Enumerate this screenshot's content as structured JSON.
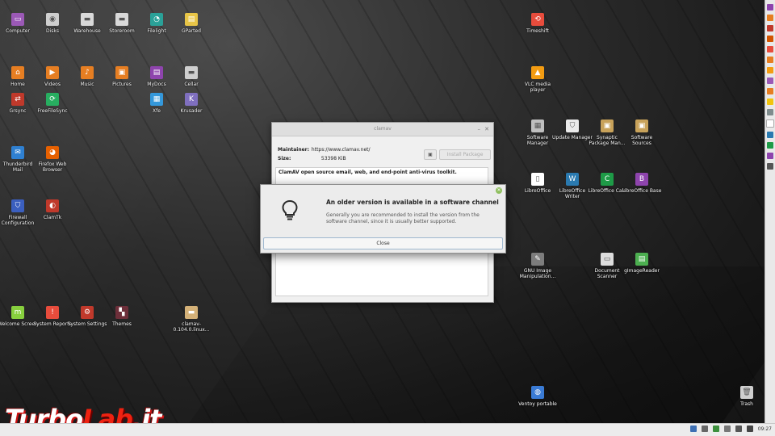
{
  "desktop": {
    "icons": [
      {
        "id": "computer",
        "label": "Computer",
        "icon": "monitor-icon",
        "color": "#9b59b6"
      },
      {
        "id": "disks",
        "label": "Disks",
        "icon": "disks-icon",
        "color": "#cfcfcf"
      },
      {
        "id": "warehouse",
        "label": "Warehouse",
        "icon": "drive-icon",
        "color": "#d9d9d9"
      },
      {
        "id": "storeroom",
        "label": "Storeroom",
        "icon": "drive-icon",
        "color": "#d9d9d9"
      },
      {
        "id": "filelight",
        "label": "Filelight",
        "icon": "filelight-icon",
        "color": "#2aa198"
      },
      {
        "id": "gparted",
        "label": "GParted",
        "icon": "gparted-icon",
        "color": "#e8c547"
      },
      {
        "id": "timeshift",
        "label": "Timeshift",
        "icon": "timeshift-icon",
        "color": "#e74c3c"
      },
      {
        "id": "home",
        "label": "Home",
        "icon": "folder-home-icon",
        "color": "#e67e22"
      },
      {
        "id": "videos",
        "label": "Videos",
        "icon": "folder-videos-icon",
        "color": "#e67e22"
      },
      {
        "id": "music",
        "label": "Music",
        "icon": "folder-music-icon",
        "color": "#e67e22"
      },
      {
        "id": "pictures",
        "label": "Pictures",
        "icon": "folder-pictures-icon",
        "color": "#e67e22"
      },
      {
        "id": "mydocs",
        "label": "MyDocs",
        "icon": "mydocs-icon",
        "color": "#8e44ad"
      },
      {
        "id": "cellar",
        "label": "Cellar",
        "icon": "folder-icon",
        "color": "#cfcfcf"
      },
      {
        "id": "vlc",
        "label": "VLC media player",
        "icon": "vlc-cone-icon",
        "color": "#f39c12"
      },
      {
        "id": "grsync",
        "label": "Grsync",
        "icon": "grsync-icon",
        "color": "#c0392b"
      },
      {
        "id": "freefilesync",
        "label": "FreeFileSync",
        "icon": "sync-icon",
        "color": "#27ae60"
      },
      {
        "id": "xfe",
        "label": "Xfe",
        "icon": "xfe-icon",
        "color": "#3498db"
      },
      {
        "id": "krusader",
        "label": "Krusader",
        "icon": "krusader-icon",
        "color": "#7f6fbf"
      },
      {
        "id": "software-manager",
        "label": "Software Manager",
        "icon": "software-manager-icon",
        "color": "#bfbfbf"
      },
      {
        "id": "update-manager",
        "label": "Update Manager",
        "icon": "shield-icon",
        "color": "#eaeaea"
      },
      {
        "id": "synaptic",
        "label": "Synaptic Package Man...",
        "icon": "package-icon",
        "color": "#c8a25a"
      },
      {
        "id": "software-sources",
        "label": "Software Sources",
        "icon": "package-icon",
        "color": "#c8a25a"
      },
      {
        "id": "thunderbird",
        "label": "Thunderbird Mail",
        "icon": "thunderbird-icon",
        "color": "#2f80d1"
      },
      {
        "id": "firefox",
        "label": "Firefox Web Browser",
        "icon": "firefox-icon",
        "color": "#e66000"
      },
      {
        "id": "libreoffice",
        "label": "LibreOffice",
        "icon": "libreoffice-icon",
        "color": "#ffffff"
      },
      {
        "id": "lo-writer",
        "label": "LibreOffice Writer",
        "icon": "writer-icon",
        "color": "#2a7ab0"
      },
      {
        "id": "lo-calc",
        "label": "LibreOffice Calc",
        "icon": "calc-icon",
        "color": "#1e9b47"
      },
      {
        "id": "lo-base",
        "label": "LibreOffice Base",
        "icon": "base-icon",
        "color": "#8e44ad"
      },
      {
        "id": "firewall",
        "label": "Firewall Configuration",
        "icon": "firewall-shield-icon",
        "color": "#3b5fbf"
      },
      {
        "id": "clamtk",
        "label": "ClamTk",
        "icon": "clamtk-icon",
        "color": "#c0392b"
      },
      {
        "id": "gimp",
        "label": "GNU Image Manipulation...",
        "icon": "gimp-icon",
        "color": "#7d7d7d"
      },
      {
        "id": "document-scanner",
        "label": "Document Scanner",
        "icon": "scanner-icon",
        "color": "#dddddd"
      },
      {
        "id": "gimagereader",
        "label": "gImageReader",
        "icon": "gimagereader-icon",
        "color": "#4caf50"
      },
      {
        "id": "welcome",
        "label": "Welcome Screen",
        "icon": "mint-icon",
        "color": "#87cf3e"
      },
      {
        "id": "system-reports",
        "label": "System Reports",
        "icon": "report-icon",
        "color": "#e74c3c"
      },
      {
        "id": "system-settings",
        "label": "System Settings",
        "icon": "settings-icon",
        "color": "#c0392b"
      },
      {
        "id": "themes",
        "label": "Themes",
        "icon": "themes-icon",
        "color": "#6d2f3a"
      },
      {
        "id": "clamav-archive",
        "label": "clamav-0.104.0.linux...",
        "icon": "archive-icon",
        "color": "#d4b178"
      },
      {
        "id": "ventoy",
        "label": "Ventoy portable",
        "icon": "ventoy-icon",
        "color": "#3a7bd5"
      },
      {
        "id": "trash",
        "label": "Trash",
        "icon": "trash-icon",
        "color": "#cfcfcf"
      }
    ]
  },
  "package_window": {
    "title": "clamav",
    "maintainer_label": "Maintainer:",
    "maintainer_value": "https://www.clamav.net/",
    "size_label": "Size:",
    "size_value": "53398 KiB",
    "install_label": "Install Package",
    "description": "ClamAV open source email, web, and end-point anti-virus toolkit."
  },
  "dialog": {
    "title": "An older version is available in a software channel",
    "message": "Generally you are recommended to install the version from the software channel, since it is usually better supported.",
    "close_label": "Close"
  },
  "taskbar": {
    "clock": "09:27"
  },
  "watermark": {
    "text_white_1": "Turbo",
    "text_red": "Lab",
    "text_white_2": ".it"
  }
}
